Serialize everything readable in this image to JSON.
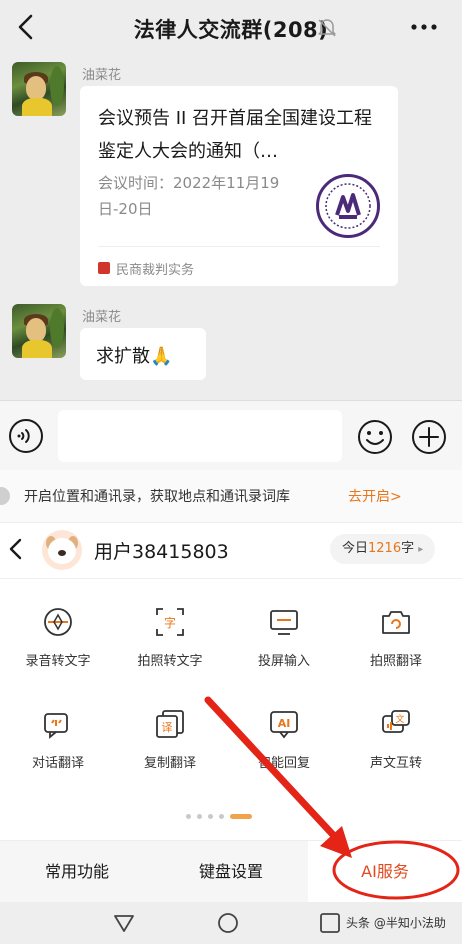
{
  "header": {
    "title": "法律人交流群(208)",
    "back_icon": "chevron-left-icon",
    "mute_icon": "bell-muted-icon",
    "more_icon": "more-dots-icon"
  },
  "messages": [
    {
      "sender": "油菜花",
      "card": {
        "title": "会议预告 II 召开首届全国建设工程鉴定人大会的通知（…",
        "description": "会议时间：2022年11月19日-20日",
        "source": "民商裁判实务"
      }
    },
    {
      "sender": "油菜花",
      "text": "求扩散🙏"
    }
  ],
  "input_bar": {
    "voice_icon": "voice-icon",
    "placeholder": "",
    "emoji_icon": "emoji-icon",
    "plus_icon": "plus-icon"
  },
  "keyboard": {
    "tip": {
      "text": "开启位置和通讯录，获取地点和通讯录词库",
      "link": "去开启>"
    },
    "user": {
      "name": "用户38415803",
      "today_prefix": "今日",
      "today_count": "1216",
      "today_suffix": "字",
      "arrow": "▸"
    },
    "tools": [
      {
        "label": "录音转文字",
        "icon": "record-to-text-icon"
      },
      {
        "label": "拍照转文字",
        "icon": "photo-to-text-icon"
      },
      {
        "label": "投屏输入",
        "icon": "screen-cast-input-icon"
      },
      {
        "label": "拍照翻译",
        "icon": "photo-translate-icon"
      },
      {
        "label": "对话翻译",
        "icon": "dialogue-translate-icon"
      },
      {
        "label": "复制翻译",
        "icon": "copy-translate-icon"
      },
      {
        "label": "智能回复",
        "icon": "ai-reply-icon"
      },
      {
        "label": "声文互转",
        "icon": "voice-text-convert-icon"
      }
    ],
    "pager": {
      "pages": 5,
      "active": 5
    },
    "tabs": [
      "常用功能",
      "键盘设置",
      "AI服务"
    ]
  },
  "system_nav": {
    "icons": [
      "back-triangle-icon",
      "home-circle-icon",
      "recents-square-icon"
    ],
    "watermark": "头条 @半知小法助"
  },
  "colors": {
    "accent": "#e8761a",
    "annotation_red": "#e32417",
    "chat_bg": "#ededed"
  }
}
